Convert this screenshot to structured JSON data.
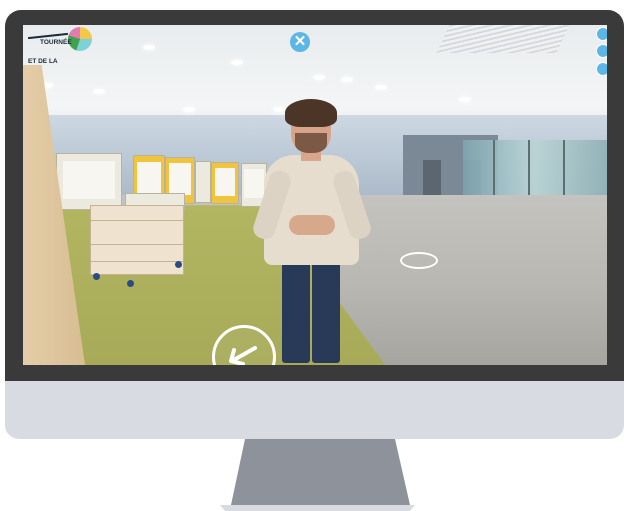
{
  "logo": {
    "line1": "TOURNÉE",
    "line2": "ET DE LA"
  },
  "controls": {
    "close_glyph": "✕",
    "side_buttons": [
      "info-icon",
      "settings-icon",
      "share-icon"
    ]
  },
  "colors": {
    "accent": "#5cb7e6",
    "frame": "#3a3a3a",
    "chin": "#d8dbe2",
    "stand": "#8e929a"
  }
}
